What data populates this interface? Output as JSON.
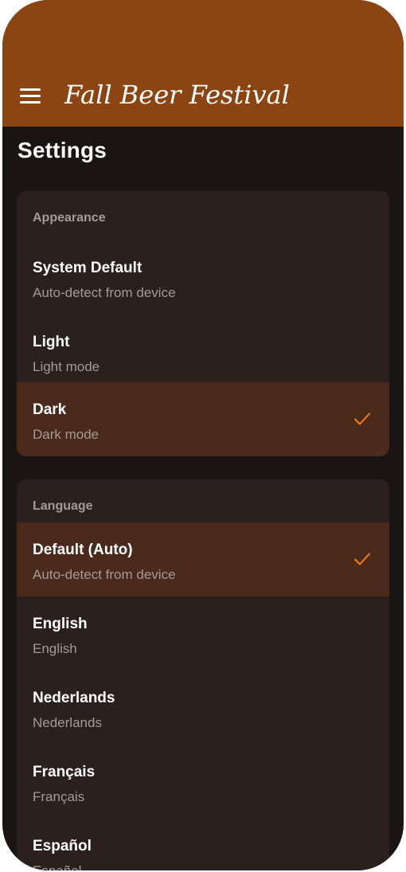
{
  "header": {
    "menu_icon": "hamburger-menu-icon",
    "logo_text": "Fall Beer Festival",
    "background": "#8b4513"
  },
  "page": {
    "title": "Settings"
  },
  "appearance": {
    "label": "Appearance",
    "options": [
      {
        "title": "System Default",
        "subtitle": "Auto-detect from device",
        "selected": false
      },
      {
        "title": "Light",
        "subtitle": "Light mode",
        "selected": false
      },
      {
        "title": "Dark",
        "subtitle": "Dark mode",
        "selected": true
      }
    ]
  },
  "language": {
    "label": "Language",
    "options": [
      {
        "title": "Default (Auto)",
        "subtitle": "Auto-detect from device",
        "selected": true
      },
      {
        "title": "English",
        "subtitle": "English",
        "selected": false
      },
      {
        "title": "Nederlands",
        "subtitle": "Nederlands",
        "selected": false
      },
      {
        "title": "Français",
        "subtitle": "Français",
        "selected": false
      },
      {
        "title": "Español",
        "subtitle": "Español",
        "selected": false
      }
    ]
  },
  "colors": {
    "accent": "#ff7a1a",
    "background": "#1b1414",
    "card": "#2b201e",
    "selected": "#4a2a1b",
    "muted_text": "#a59a96"
  },
  "icons": {
    "selected_indicator": "checkmark-icon"
  }
}
